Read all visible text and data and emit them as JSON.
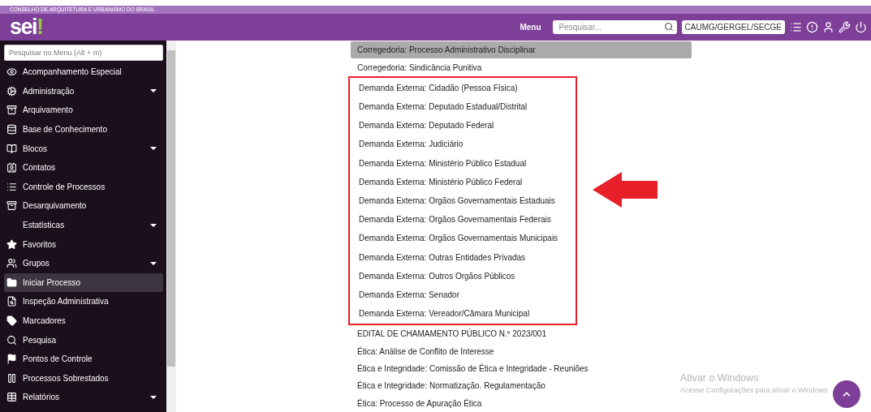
{
  "org_banner": "CONSELHO DE ARQUITETURA E URBANISMO DO BRASIL",
  "header": {
    "logo": "sei",
    "logo_mark": "!",
    "menu_label": "Menu",
    "search": {
      "placeholder": "Pesquisar..."
    },
    "unit": "CAUMG/GERGEL/SECGE"
  },
  "sidebar": {
    "search": {
      "placeholder": "Pesquisar no Menu (Alt + m)"
    },
    "items": [
      {
        "label": "Acompanhamento Especial",
        "expandable": false,
        "selected": false
      },
      {
        "label": "Administração",
        "expandable": true,
        "selected": false
      },
      {
        "label": "Arquivamento",
        "expandable": false,
        "selected": false
      },
      {
        "label": "Base de Conhecimento",
        "expandable": false,
        "selected": false
      },
      {
        "label": "Blocos",
        "expandable": true,
        "selected": false
      },
      {
        "label": "Contatos",
        "expandable": false,
        "selected": false
      },
      {
        "label": "Controle de Processos",
        "expandable": false,
        "selected": false
      },
      {
        "label": "Desarquivamento",
        "expandable": false,
        "selected": false
      },
      {
        "label": "Estatísticas",
        "expandable": true,
        "selected": false
      },
      {
        "label": "Favoritos",
        "expandable": false,
        "selected": false
      },
      {
        "label": "Grupos",
        "expandable": true,
        "selected": false
      },
      {
        "label": "Iniciar Processo",
        "expandable": false,
        "selected": true
      },
      {
        "label": "Inspeção Administrativa",
        "expandable": false,
        "selected": false
      },
      {
        "label": "Marcadores",
        "expandable": false,
        "selected": false
      },
      {
        "label": "Pesquisa",
        "expandable": false,
        "selected": false
      },
      {
        "label": "Pontos de Controle",
        "expandable": false,
        "selected": false
      },
      {
        "label": "Processos Sobrestados",
        "expandable": false,
        "selected": false
      },
      {
        "label": "Relatórios",
        "expandable": true,
        "selected": false
      }
    ]
  },
  "process_types": [
    {
      "kind": "item",
      "label": "Corregedoria: Processo Administrativo Disciplinar",
      "selected": true
    },
    {
      "kind": "item",
      "label": "Corregedoria: Sindicância Punitiva",
      "selected": false
    },
    {
      "kind": "highlight_group",
      "items": [
        {
          "label": "Demanda Externa: Cidadão (Pessoa Física)",
          "selected": false
        },
        {
          "label": "Demanda Externa: Deputado Estadual/Distrital",
          "selected": false
        },
        {
          "label": "Demanda Externa: Deputado Federal",
          "selected": false
        },
        {
          "label": "Demanda Externa: Judiciário",
          "selected": false
        },
        {
          "label": "Demanda Externa: Ministério Público Estadual",
          "selected": false
        },
        {
          "label": "Demanda Externa: Ministério Público Federal",
          "selected": false
        },
        {
          "label": "Demanda Externa: Orgãos Governamentais Estaduais",
          "selected": false
        },
        {
          "label": "Demanda Externa: Orgãos Governamentais Federais",
          "selected": false
        },
        {
          "label": "Demanda Externa: Orgãos Governamentais Municipais",
          "selected": false
        },
        {
          "label": "Demanda Externa: Outras Entidades Privadas",
          "selected": false
        },
        {
          "label": "Demanda Externa: Outros Orgãos Públicos",
          "selected": false
        },
        {
          "label": "Demanda Externa: Senador",
          "selected": false
        },
        {
          "label": "Demanda Externa: Vereador/Câmara Municipal",
          "selected": false
        }
      ]
    },
    {
      "kind": "item",
      "label": "EDITAL DE CHAMAMENTO PÚBLICO N.º 2023/001",
      "selected": false
    },
    {
      "kind": "item",
      "label": "Ética: Análise de Conflito de Interesse",
      "selected": false
    },
    {
      "kind": "item",
      "label": "Ética e Integridade: Comissão de Ética e Integridade - Reuniões",
      "selected": false
    },
    {
      "kind": "item",
      "label": "Ética e Integridade: Normatização. Regulamentação",
      "selected": false
    },
    {
      "kind": "item",
      "label": "Ética: Processo de Apuração Ética",
      "selected": false
    }
  ],
  "activation_notice": {
    "title": "Ativar o Windows",
    "text": "Acesse Configurações para ativar o Windows"
  }
}
